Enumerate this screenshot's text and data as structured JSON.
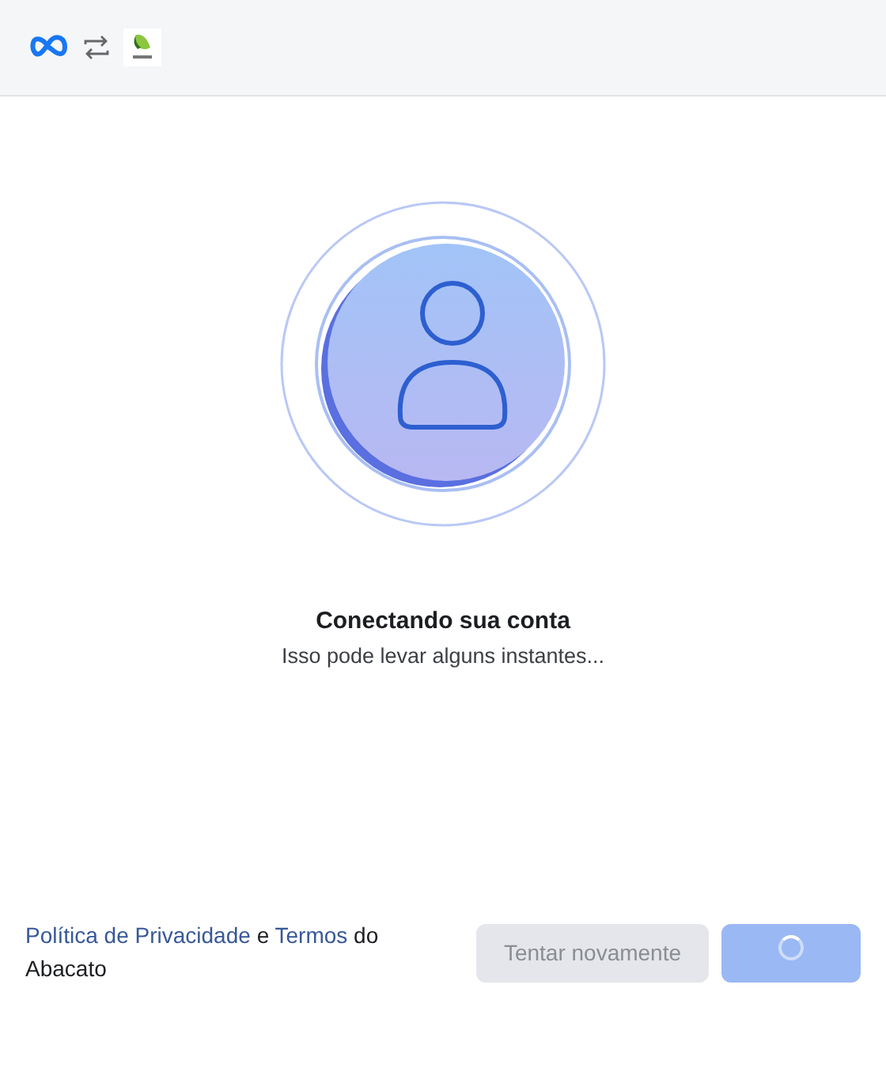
{
  "status": {
    "title": "Conectando sua conta",
    "subtitle": "Isso pode levar alguns instantes..."
  },
  "footer": {
    "legal": [
      {
        "kind": "link",
        "text": "Política de Privacidade"
      },
      {
        "kind": "text",
        "text": "e"
      },
      {
        "kind": "link",
        "text": "Termos"
      },
      {
        "kind": "text",
        "text": "do Abacato"
      }
    ]
  },
  "buttons": [
    {
      "kind": "secondary",
      "label": "Tentar novamente",
      "disabled": true,
      "loading": false
    },
    {
      "kind": "primary",
      "disabled": true,
      "loading": true
    }
  ]
}
